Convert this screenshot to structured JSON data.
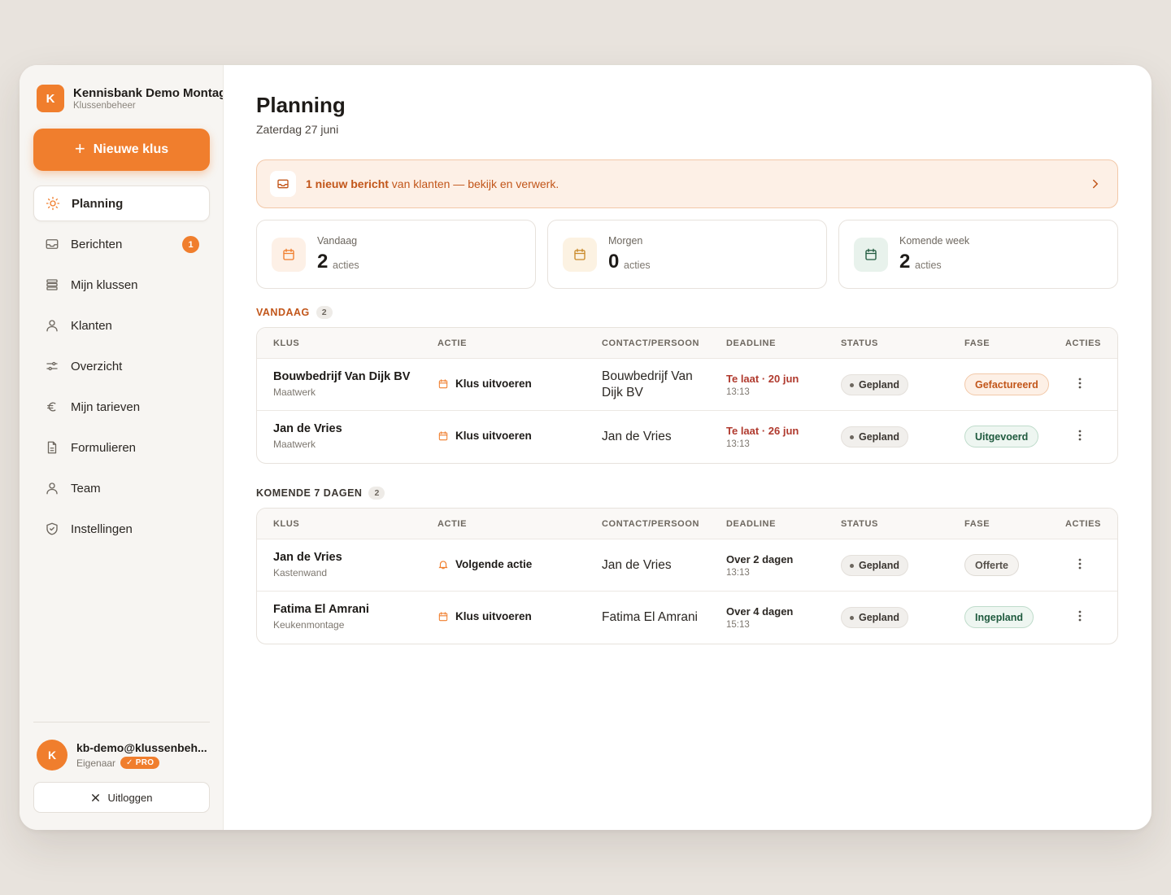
{
  "brand": {
    "initial": "K",
    "name": "Kennisbank Demo Montage",
    "subtitle": "Klussenbeheer"
  },
  "new_button": {
    "label": "Nieuwe klus",
    "icon": "plus-icon"
  },
  "nav": {
    "items": [
      {
        "label": "Planning",
        "icon": "sun-icon",
        "active": true
      },
      {
        "label": "Berichten",
        "icon": "inbox-icon",
        "badge": "1"
      },
      {
        "label": "Mijn klussen",
        "icon": "stack-icon"
      },
      {
        "label": "Klanten",
        "icon": "user-icon"
      },
      {
        "label": "Overzicht",
        "icon": "sliders-icon"
      },
      {
        "label": "Mijn tarieven",
        "icon": "euro-icon"
      },
      {
        "label": "Formulieren",
        "icon": "document-icon"
      },
      {
        "label": "Team",
        "icon": "user-icon"
      },
      {
        "label": "Instellingen",
        "icon": "shield-icon"
      }
    ]
  },
  "user": {
    "initial": "K",
    "email": "kb-demo@klussenbeh...",
    "role": "Eigenaar",
    "plan": "✓ PRO"
  },
  "logout": {
    "label": "Uitloggen",
    "icon": "close-icon"
  },
  "page": {
    "title": "Planning",
    "date": "Zaterdag 27 juni"
  },
  "banner": {
    "bold": "1 nieuw bericht",
    "text": " van klanten — bekijk en verwerk.",
    "icon": "inbox-icon"
  },
  "stats": [
    {
      "label": "Vandaag",
      "value": "2",
      "unit": "acties",
      "icon": "calendar-icon",
      "color": "#f07e2d",
      "bg": "#fdf0e6"
    },
    {
      "label": "Morgen",
      "value": "0",
      "unit": "acties",
      "icon": "calendar-icon",
      "color": "#c98a2a",
      "bg": "#fcf2e2"
    },
    {
      "label": "Komende week",
      "value": "2",
      "unit": "acties",
      "icon": "calendar-icon",
      "color": "#1f5a3e",
      "bg": "#e8f2ec"
    }
  ],
  "columns": [
    "KLUS",
    "ACTIE",
    "CONTACT/PERSOON",
    "DEADLINE",
    "STATUS",
    "FASE",
    "ACTIES"
  ],
  "sections": [
    {
      "title": "VANDAAG",
      "count": "2",
      "color": "#c2561a",
      "rows": [
        {
          "name": "Bouwbedrijf Van Dijk BV",
          "sub": "Maatwerk",
          "actie": "Klus uitvoeren",
          "actie_icon": "calendar-icon",
          "contact": "Bouwbedrijf Van Dijk BV",
          "deadline": "Te laat · 20 jun",
          "time": "13:13",
          "late": true,
          "status": "Gepland",
          "fase": "Gefactureerd",
          "fase_style": "orange"
        },
        {
          "name": "Jan de Vries",
          "sub": "Maatwerk",
          "actie": "Klus uitvoeren",
          "actie_icon": "calendar-icon",
          "contact": "Jan de Vries",
          "deadline": "Te laat · 26 jun",
          "time": "13:13",
          "late": true,
          "status": "Gepland",
          "fase": "Uitgevoerd",
          "fase_style": "green"
        }
      ]
    },
    {
      "title": "KOMENDE 7 DAGEN",
      "count": "2",
      "color": "#3b3631",
      "rows": [
        {
          "name": "Jan de Vries",
          "sub": "Kastenwand",
          "actie": "Volgende actie",
          "actie_icon": "bell-icon",
          "contact": "Jan de Vries",
          "deadline": "Over 2 dagen",
          "time": "13:13",
          "late": false,
          "status": "Gepland",
          "fase": "Offerte",
          "fase_style": "grey"
        },
        {
          "name": "Fatima El Amrani",
          "sub": "Keukenmontage",
          "actie": "Klus uitvoeren",
          "actie_icon": "calendar-icon",
          "contact": "Fatima El Amrani",
          "deadline": "Over 4 dagen",
          "time": "15:13",
          "late": false,
          "status": "Gepland",
          "fase": "Ingepland",
          "fase_style": "green"
        }
      ]
    }
  ]
}
